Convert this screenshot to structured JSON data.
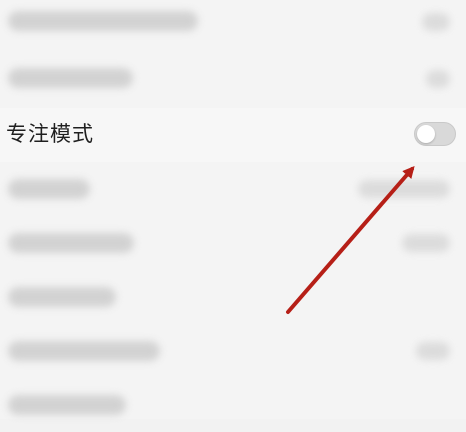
{
  "settings": {
    "focus_mode_label": "专注模式",
    "toggle_state": "off"
  },
  "colors": {
    "arrow": "#b61f17",
    "background": "#f4f4f4"
  }
}
